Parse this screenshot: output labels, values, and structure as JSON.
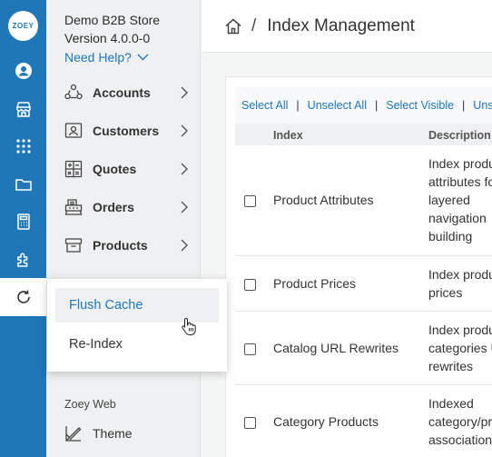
{
  "rail": {
    "logo_text": "ZOEY",
    "icons": [
      "user-icon",
      "storefront-icon",
      "apps-grid-icon",
      "folder-icon",
      "calculator-icon",
      "puzzle-icon",
      "refresh-icon"
    ]
  },
  "sidebar": {
    "store_name": "Demo B2B Store",
    "version": "Version 4.0.0-0",
    "need_help": "Need Help?",
    "items": [
      {
        "label": "Accounts",
        "icon": "accounts-icon"
      },
      {
        "label": "Customers",
        "icon": "customers-icon"
      },
      {
        "label": "Quotes",
        "icon": "quotes-icon"
      },
      {
        "label": "Orders",
        "icon": "orders-icon"
      },
      {
        "label": "Products",
        "icon": "products-icon"
      }
    ],
    "section_label": "Zoey Web",
    "theme_label": "Theme"
  },
  "header": {
    "breadcrumb_separator": "/",
    "title": "Index Management"
  },
  "toolbar": {
    "select_all": "Select All",
    "unselect_all": "Unselect All",
    "select_visible": "Select Visible",
    "unselect_visible": "Unse"
  },
  "table": {
    "columns": [
      "Index",
      "Description"
    ],
    "rows": [
      {
        "index": "Product Attributes",
        "description": "Index produ\nattributes fo\nlayered\nnavigation\nbuilding"
      },
      {
        "index": "Product Prices",
        "description": "Index produ\nprices"
      },
      {
        "index": "Catalog URL Rewrites",
        "description": "Index produ\ncategories U\nrewrites"
      },
      {
        "index": "Category Products",
        "description": "Indexed\ncategory/pro\nassociation"
      }
    ]
  },
  "flyout": {
    "items": [
      "Flush Cache",
      "Re-Index"
    ],
    "active_index": 0
  },
  "colors": {
    "brand": "#1f77b8",
    "sidebar_bg": "#eef0f1"
  }
}
